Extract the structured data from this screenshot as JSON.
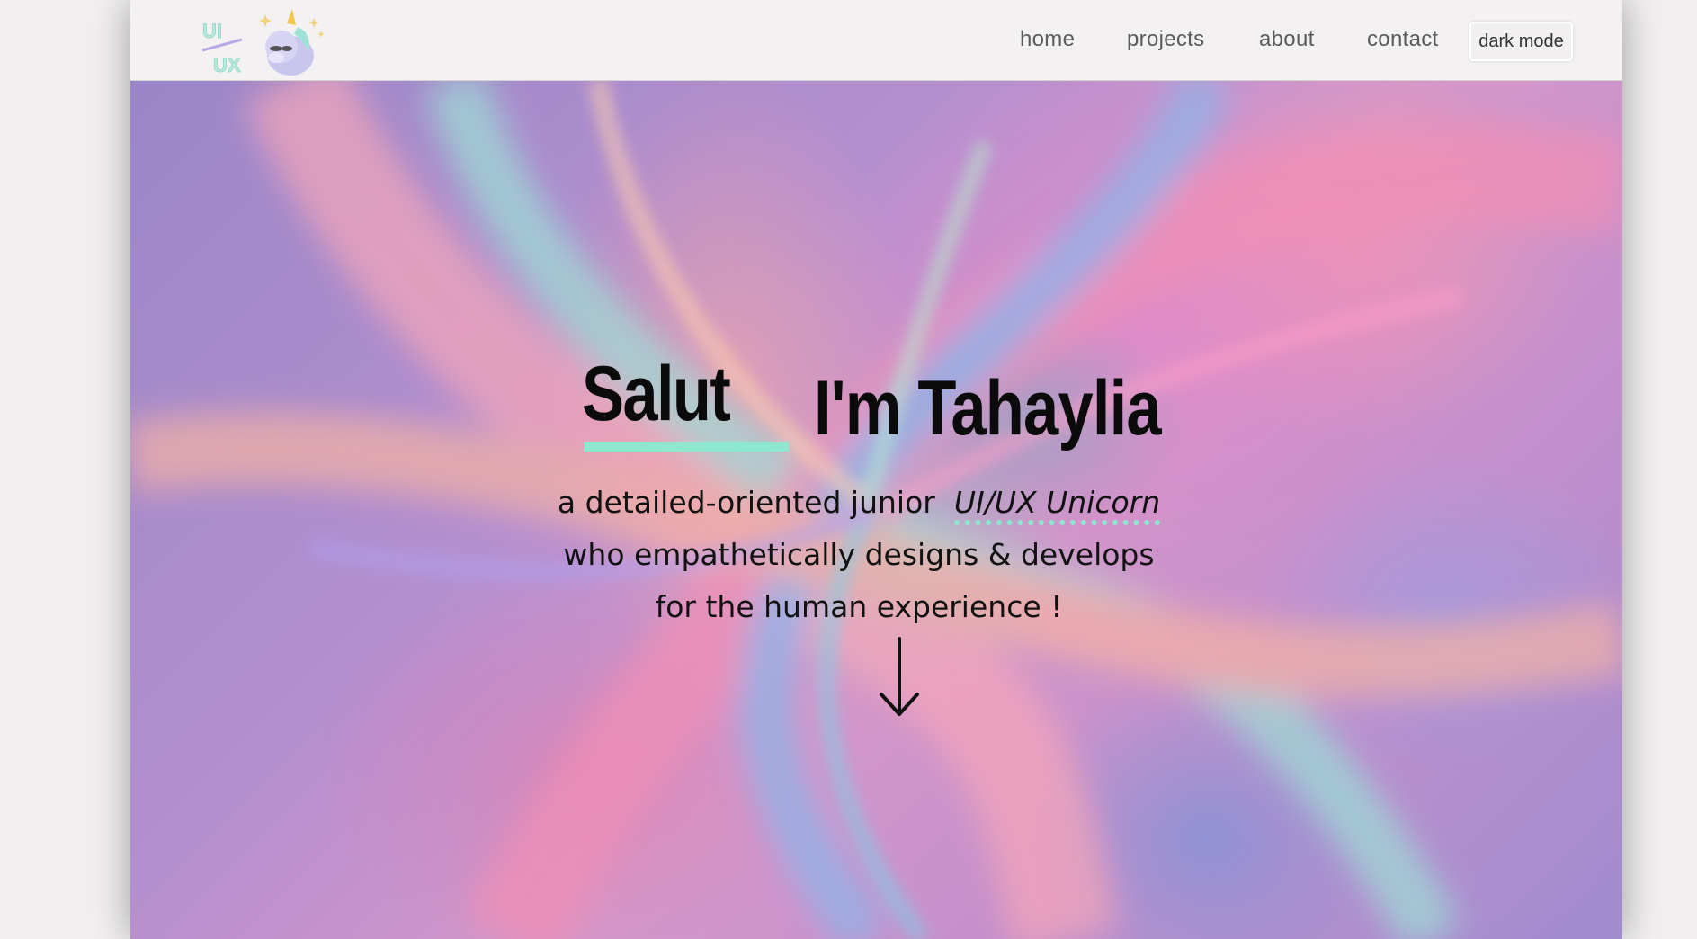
{
  "nav": {
    "logo_alt": "UI UX unicorn logo",
    "links": [
      "home",
      "projects",
      "about",
      "contact"
    ],
    "dark_mode_label": "dark mode"
  },
  "hero": {
    "greeting": "Salut",
    "name": "I'm Tahaylia",
    "tagline_line1_prefix": "a detailed-oriented junior",
    "tagline_role": "UI/UX Unicorn",
    "tagline_line2": "who empathetically designs & develops",
    "tagline_line3": "for the human experience !"
  },
  "colors": {
    "accent_mint": "#8ee8cf",
    "text": "#0b0b0b",
    "nav_bg": "#f3f1f1"
  },
  "icons": {
    "scroll_down": "down-arrow-icon",
    "logo": "unicorn-logo-icon"
  }
}
